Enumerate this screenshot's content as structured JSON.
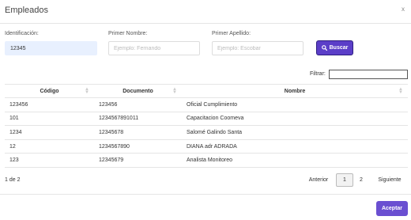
{
  "dialog": {
    "title": "Empleados",
    "close_label": "x"
  },
  "search": {
    "id_label": "Identificación:",
    "id_value": "12345",
    "first_name_label": "Primer Nombre:",
    "first_name_placeholder": "Ejemplo: Fernando",
    "last_name_label": "Primer Apellido:",
    "last_name_placeholder": "Ejemplo: Escobar",
    "search_button": "Buscar"
  },
  "filter": {
    "label": "Filtrar:"
  },
  "table": {
    "columns": [
      "Código",
      "Documento",
      "Nombre"
    ],
    "rows": [
      [
        "123456",
        "123456",
        "Oficial Cumplimiento"
      ],
      [
        "101",
        "1234567891011",
        "Capacitacion Coomeva"
      ],
      [
        "1234",
        "12345678",
        "Salomé Galindo Santa"
      ],
      [
        "12",
        "1234567890",
        "DIANA adr ADRADA"
      ],
      [
        "123",
        "12345679",
        "Analista Monitoreo"
      ]
    ]
  },
  "pagination": {
    "info": "1 de 2",
    "previous": "Anterior",
    "pages": [
      "1",
      "2"
    ],
    "next": "Siguiente"
  },
  "footer": {
    "accept_button": "Aceptar"
  },
  "colors": {
    "primary": "#5b3ec8",
    "accept": "#6a4fd1",
    "active_input": "#e8f0fe"
  },
  "icons": {
    "search": "search-icon"
  }
}
